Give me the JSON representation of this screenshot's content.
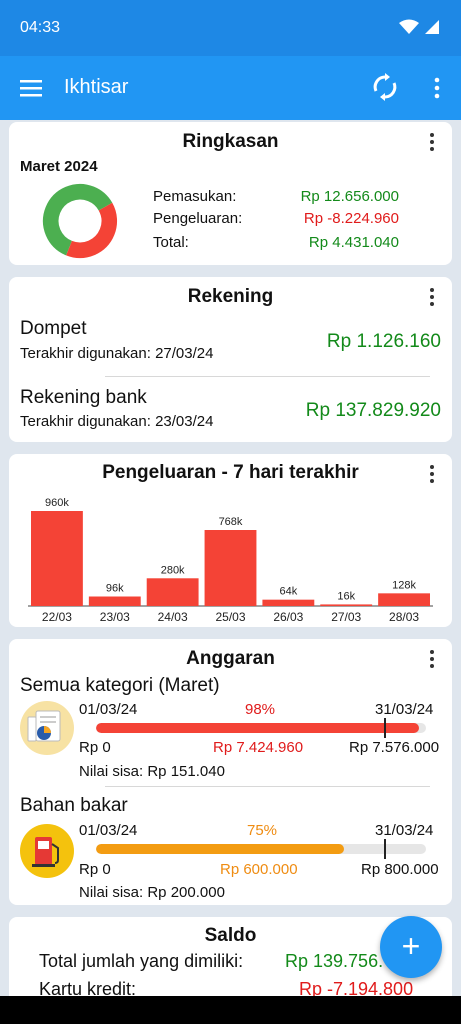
{
  "status_bar": {
    "time": "04:33",
    "wifi_icon": "wifi-icon",
    "signal_icon": "signal-icon"
  },
  "app_bar": {
    "title": "Ikhtisar",
    "menu_icon": "menu-icon",
    "sync_icon": "sync-icon",
    "more_icon": "more-vert-icon"
  },
  "summary": {
    "title": "Ringkasan",
    "month": "Maret 2024",
    "income_label": "Pemasukan:",
    "income_value": "Rp 12.656.000",
    "expense_label": "Pengeluaran:",
    "expense_value": "Rp -8.224.960",
    "total_label": "Total:",
    "total_value": "Rp 4.431.040",
    "donut": {
      "income": 12656000,
      "expense": 8224960,
      "income_color": "#4caf50",
      "expense_color": "#f44336"
    }
  },
  "accounts": {
    "title": "Rekening",
    "items": [
      {
        "name": "Dompet",
        "last_used": "Terakhir digunakan: 27/03/24",
        "balance": "Rp 1.126.160"
      },
      {
        "name": "Rekening bank",
        "last_used": "Terakhir digunakan: 23/03/24",
        "balance": "Rp 137.829.920"
      }
    ]
  },
  "expenses_chart": {
    "title": "Pengeluaran - 7 hari terakhir",
    "chart_data": {
      "type": "bar",
      "categories": [
        "22/03",
        "23/03",
        "24/03",
        "25/03",
        "26/03",
        "27/03",
        "28/03"
      ],
      "values": [
        960000,
        96000,
        280000,
        768000,
        64000,
        16000,
        128000
      ],
      "data_labels": [
        "960k",
        "96k",
        "280k",
        "768k",
        "64k",
        "16k",
        "128k"
      ],
      "bar_color": "#f44336",
      "ylim": [
        0,
        960000
      ]
    }
  },
  "budget": {
    "title": "Anggaran",
    "items": [
      {
        "name": "Semua kategori (Maret)",
        "icon": "budget-report-icon",
        "start_date": "01/03/24",
        "end_date": "31/03/24",
        "percent_label": "98%",
        "progress": 0.98,
        "bar_color": "#f44336",
        "min_label": "Rp 0",
        "spent_label": "Rp 7.424.960",
        "limit_label": "Rp 7.576.000",
        "remaining": "Nilai sisa:  Rp 151.040"
      },
      {
        "name": "Bahan bakar",
        "icon": "fuel-pump-icon",
        "start_date": "01/03/24",
        "end_date": "31/03/24",
        "percent_label": "75%",
        "progress": 0.75,
        "bar_color": "#f39c12",
        "min_label": "Rp 0",
        "spent_label": "Rp 600.000",
        "limit_label": "Rp 800.000",
        "remaining": "Nilai sisa:  Rp 200.000"
      }
    ]
  },
  "balance": {
    "title": "Saldo",
    "total_label": "Total jumlah yang dimiliki:",
    "total_value": "Rp 139.756.",
    "credit_label": "Kartu kredit:",
    "credit_value": "Rp -7.194.800"
  },
  "fab": {
    "icon": "add-icon",
    "label": "+"
  }
}
